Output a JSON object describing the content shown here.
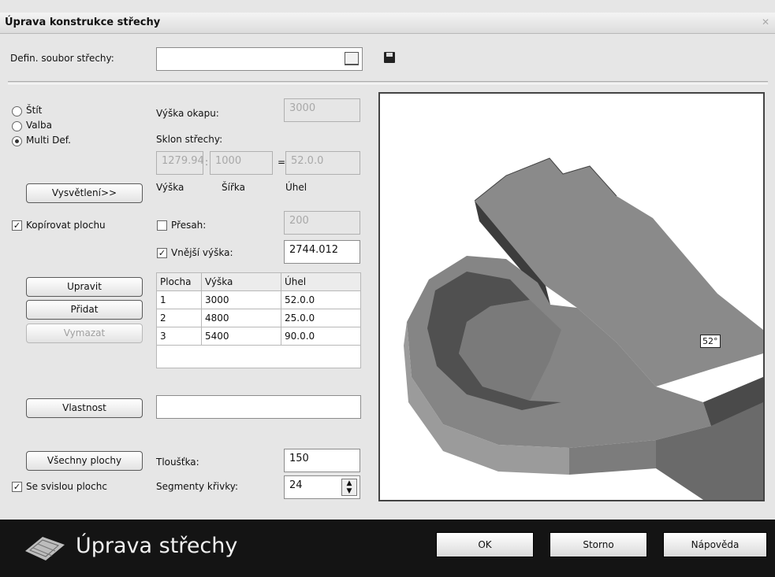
{
  "window": {
    "title": "Úprava konstrukce střechy"
  },
  "definition": {
    "label": "Defin. soubor střechy:",
    "value": ""
  },
  "roof_type": {
    "options": [
      "Štít",
      "Valba",
      "Multi Def."
    ],
    "selected": "Multi Def."
  },
  "eave_height": {
    "label": "Výška okapu:",
    "value": "3000"
  },
  "slope": {
    "label": "Sklon střechy:",
    "height_value": "1279.94",
    "width_value": "1000",
    "angle_value": "52.0.0",
    "height_label": "Výška",
    "width_label": "Šířka",
    "angle_label": "Úhel"
  },
  "explain_button": "Vysvětlení>>",
  "copy_surface": {
    "label": "Kopírovat plochu",
    "checked": true
  },
  "overhang": {
    "label": "Přesah:",
    "checked": false,
    "value": "200"
  },
  "outer_height": {
    "label": "Vnější výška:",
    "checked": true,
    "value": "2744.012"
  },
  "buttons": {
    "edit": "Upravit",
    "add": "Přidat",
    "delete": "Vymazat",
    "property": "Vlastnost",
    "all_surfaces": "Všechny plochy"
  },
  "table": {
    "headers": [
      "Plocha",
      "Výška",
      "Úhel"
    ],
    "rows": [
      [
        "1",
        "3000",
        "52.0.0"
      ],
      [
        "2",
        "4800",
        "25.0.0"
      ],
      [
        "3",
        "5400",
        "90.0.0"
      ]
    ]
  },
  "property_value": "",
  "thickness": {
    "label": "Tloušťka:",
    "value": "150"
  },
  "segments": {
    "label": "Segmenty křivky:",
    "value": "24"
  },
  "vertical_surface": {
    "label": "Se svislou plochc",
    "checked": true
  },
  "preview": {
    "angle_label": "52°"
  },
  "footer": {
    "brand": "Úprava střechy",
    "ok": "OK",
    "cancel": "Storno",
    "help": "Nápověda"
  }
}
